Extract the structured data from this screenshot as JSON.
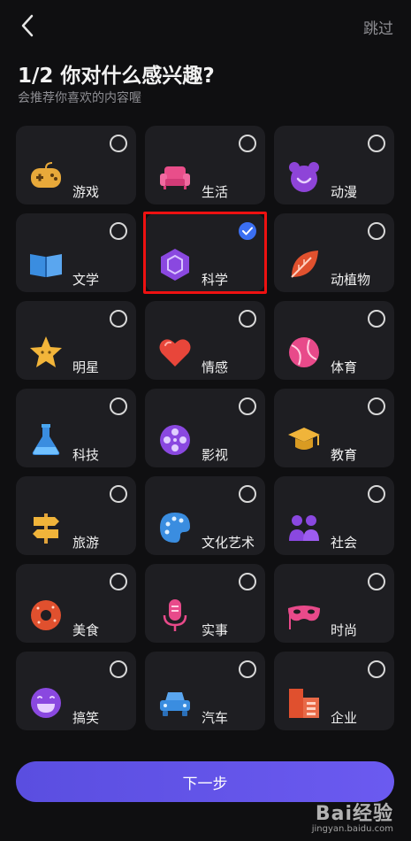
{
  "header": {
    "skip_label": "跳过"
  },
  "intro": {
    "title": "1/2 你对什么感兴趣?",
    "subtitle": "会推荐你喜欢的内容喔"
  },
  "interests": [
    {
      "label": "游戏",
      "icon": "gamepad-icon",
      "selected": false
    },
    {
      "label": "生活",
      "icon": "sofa-icon",
      "selected": false
    },
    {
      "label": "动漫",
      "icon": "bear-face-icon",
      "selected": false
    },
    {
      "label": "文学",
      "icon": "open-book-icon",
      "selected": false
    },
    {
      "label": "科学",
      "icon": "hexagon-molecule-icon",
      "selected": true
    },
    {
      "label": "动植物",
      "icon": "leaf-icon",
      "selected": false
    },
    {
      "label": "明星",
      "icon": "star-icon",
      "selected": false
    },
    {
      "label": "情感",
      "icon": "heart-icon",
      "selected": false
    },
    {
      "label": "体育",
      "icon": "ball-icon",
      "selected": false
    },
    {
      "label": "科技",
      "icon": "flask-icon",
      "selected": false
    },
    {
      "label": "影视",
      "icon": "film-reel-icon",
      "selected": false
    },
    {
      "label": "教育",
      "icon": "graduation-cap-icon",
      "selected": false
    },
    {
      "label": "旅游",
      "icon": "signpost-icon",
      "selected": false
    },
    {
      "label": "文化艺术",
      "icon": "palette-icon",
      "selected": false
    },
    {
      "label": "社会",
      "icon": "people-icon",
      "selected": false
    },
    {
      "label": "美食",
      "icon": "donut-icon",
      "selected": false
    },
    {
      "label": "实事",
      "icon": "microphone-icon",
      "selected": false
    },
    {
      "label": "时尚",
      "icon": "mask-icon",
      "selected": false
    },
    {
      "label": "搞笑",
      "icon": "laughing-face-icon",
      "selected": false
    },
    {
      "label": "汽车",
      "icon": "car-icon",
      "selected": false
    },
    {
      "label": "企业",
      "icon": "building-icon",
      "selected": false
    }
  ],
  "footer": {
    "next_label": "下一步"
  },
  "watermark": {
    "brand": "Bai经验",
    "url": "jingyan.baidu.com"
  },
  "colors": {
    "accent": "#6b5af0",
    "check": "#3b6ff2",
    "highlight": "#ee1111"
  }
}
